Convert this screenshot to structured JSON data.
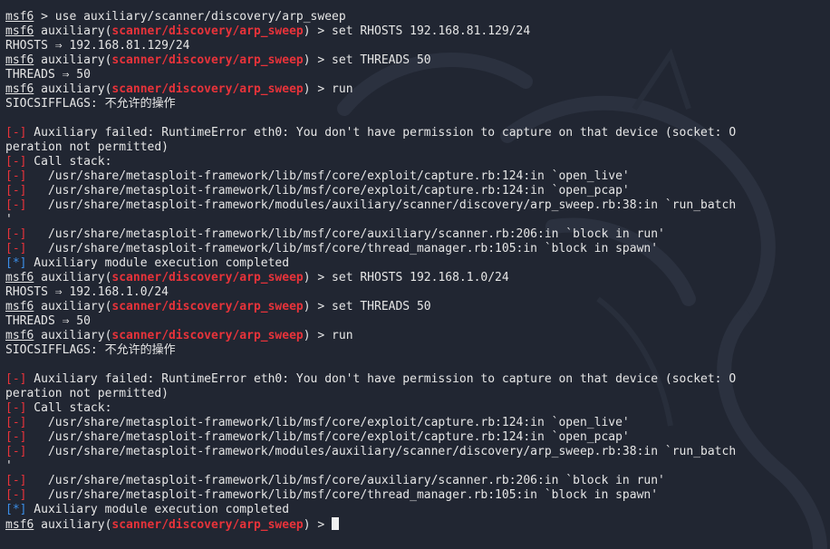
{
  "prompt": {
    "host": "msf6",
    "module_prefix": " auxiliary(",
    "module_name": "scanner/discovery/arp_sweep",
    "suffix_run": ") > run",
    "suffix_set_rhosts_1": ") > set RHOSTS 192.168.81.129/24",
    "suffix_set_threads": ") > set THREADS 50",
    "suffix_set_rhosts_2": ") > set RHOSTS 192.168.1.0/24",
    "suffix_empty": ") > "
  },
  "first_command": " > use auxiliary/scanner/discovery/arp_sweep",
  "output": {
    "rhosts_1": "RHOSTS ⇒ 192.168.81.129/24",
    "rhosts_2": "RHOSTS ⇒ 192.168.1.0/24",
    "threads": "THREADS ⇒ 50",
    "siocsiff": "SIOCSIFFLAGS: 不允许的操作",
    "err_tag": "[-]",
    "info_tag": "[*]",
    "failed": " Auxiliary failed: RuntimeError eth0: You don't have permission to capture on that device (socket: O",
    "failed_wrap": "peration not permitted)",
    "call_stack": " Call stack:",
    "stack": [
      "   /usr/share/metasploit-framework/lib/msf/core/exploit/capture.rb:124:in `open_live'",
      "   /usr/share/metasploit-framework/lib/msf/core/exploit/capture.rb:124:in `open_pcap'",
      "   /usr/share/metasploit-framework/modules/auxiliary/scanner/discovery/arp_sweep.rb:38:in `run_batch"
    ],
    "stack_wrap": "'",
    "stack_tail": [
      "   /usr/share/metasploit-framework/lib/msf/core/auxiliary/scanner.rb:206:in `block in run'",
      "   /usr/share/metasploit-framework/lib/msf/core/thread_manager.rb:105:in `block in spawn'"
    ],
    "completed": " Auxiliary module execution completed"
  },
  "colors": {
    "background": "#212632",
    "module_red": "#e8333a",
    "info_blue": "#3b8ee8",
    "text": "#e6e6e6"
  }
}
